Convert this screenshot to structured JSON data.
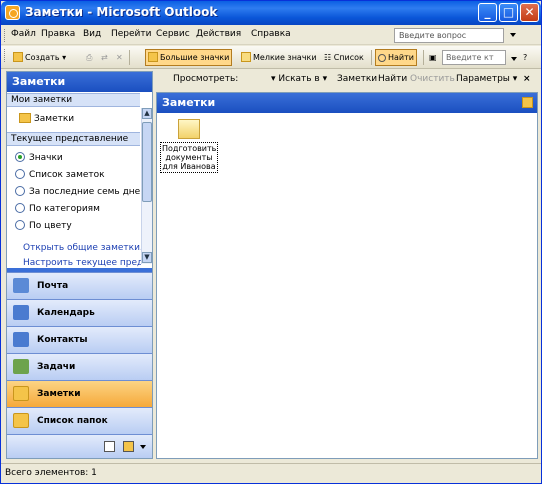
{
  "window": {
    "title": "Заметки - Microsoft Outlook",
    "buttons": {
      "minimize": "_",
      "maximize": "□",
      "close": "✕"
    }
  },
  "menubar": {
    "items": [
      "Файл",
      "Правка",
      "Вид",
      "Перейти",
      "Сервис",
      "Действия",
      "Справка"
    ],
    "question_placeholder": "Введите вопрос"
  },
  "toolbar": {
    "create": "Создать",
    "large_icons": "Большие значки",
    "small_icons": "Мелкие значки",
    "list": "Список",
    "find": "Найти",
    "search_placeholder": "Введите кт"
  },
  "nav": {
    "header": "Заметки",
    "my_notes_title": "Мои заметки",
    "folder": "Заметки",
    "current_view_title": "Текущее представление",
    "views": [
      {
        "label": "Значки",
        "selected": true
      },
      {
        "label": "Список заметок",
        "selected": false
      },
      {
        "label": "За последние семь дней",
        "selected": false
      },
      {
        "label": "По категориям",
        "selected": false
      },
      {
        "label": "По цвету",
        "selected": false
      }
    ],
    "links": [
      "Открыть общие заметки...",
      "Настроить текущее представление..."
    ],
    "buttons": [
      {
        "label": "Почта",
        "icon": "mail-icon",
        "color": "#5b8ad6"
      },
      {
        "label": "Календарь",
        "icon": "calendar-icon",
        "color": "#4a7bd0"
      },
      {
        "label": "Контакты",
        "icon": "contacts-icon",
        "color": "#4a7bd0"
      },
      {
        "label": "Задачи",
        "icon": "tasks-icon",
        "color": "#6da34d"
      },
      {
        "label": "Заметки",
        "icon": "notes-icon",
        "color": "#f4c449",
        "selected": true
      },
      {
        "label": "Список папок",
        "icon": "folder-list-icon",
        "color": "#f4c449"
      }
    ]
  },
  "viewbar": {
    "view_label": "Просмотреть:",
    "search_in": "Искать в",
    "scope": "Заметки",
    "find": "Найти",
    "clear": "Очистить",
    "options": "Параметры",
    "close": "×"
  },
  "content": {
    "header": "Заметки",
    "notes": [
      {
        "title": "Подготовить документы для Иванова"
      }
    ]
  },
  "status": {
    "text": "Всего элементов: 1"
  }
}
